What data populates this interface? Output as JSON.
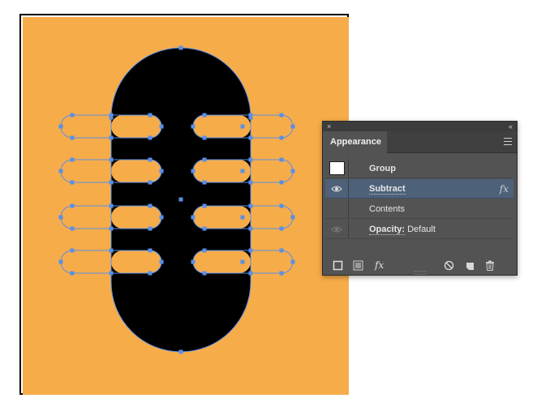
{
  "colors": {
    "artboard_bg": "#F7AC4A",
    "shape_fill": "#000000",
    "path_stroke": "#5A8FE6",
    "panel_bg": "#535353",
    "selected_row": "#4D6179"
  },
  "canvas": {
    "selection": "Group with Subtract effect",
    "icons": [
      "anchor-point-icon",
      "center-point-icon"
    ]
  },
  "panel": {
    "title": "Appearance",
    "collapse_glyph": "«",
    "close_glyph": "×",
    "rows": {
      "group": "Group",
      "subtract": "Subtract",
      "subtract_fx": "fx",
      "contents": "Contents",
      "opacity_label": "Opacity:",
      "opacity_value": " Default"
    },
    "footer_icons": [
      "add-new-stroke-icon",
      "add-new-fill-icon",
      "add-new-effect-icon",
      "clear-appearance-icon",
      "duplicate-item-icon",
      "delete-item-icon"
    ],
    "fx_label": "fx"
  }
}
